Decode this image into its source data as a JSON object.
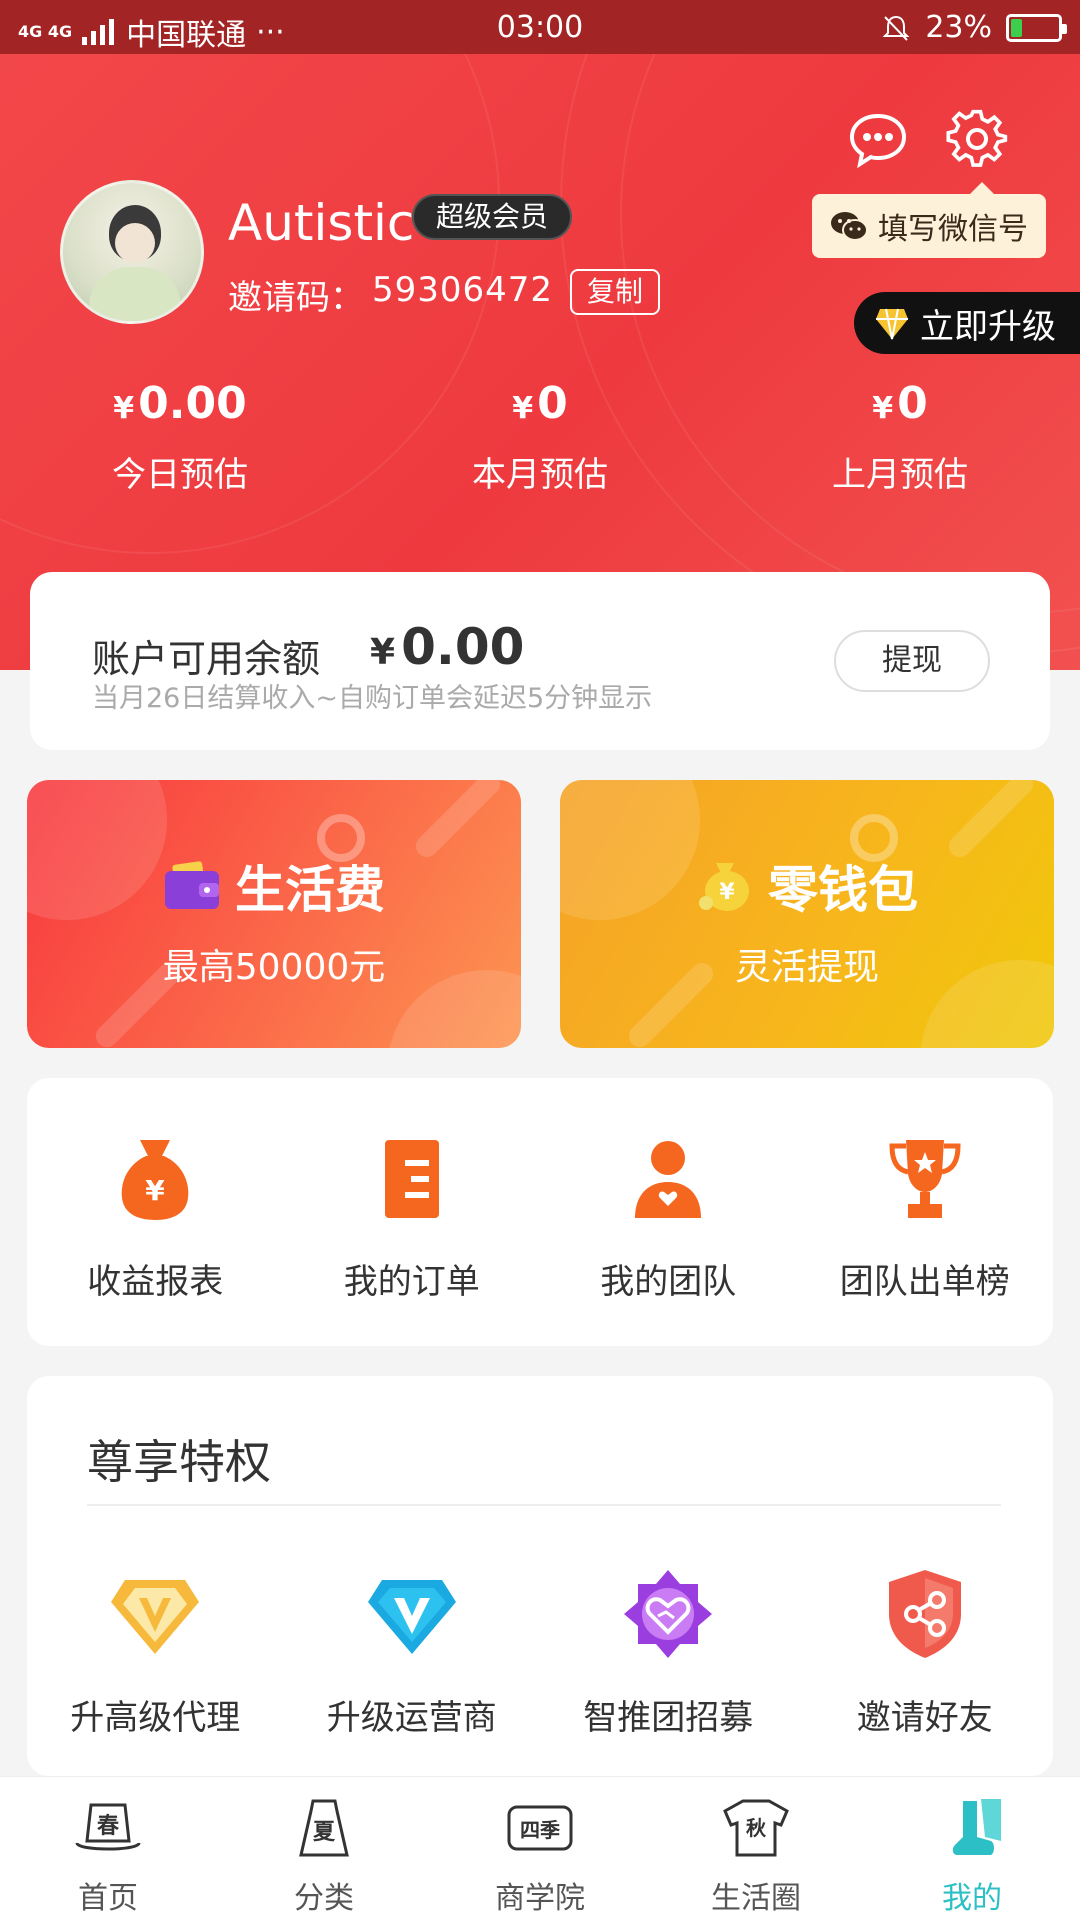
{
  "status_bar": {
    "network": "4G 4G",
    "carrier": "中国联通",
    "more": "···",
    "time": "03:00",
    "battery_text": "23%",
    "battery_level": 0.23
  },
  "profile": {
    "username": "Autistic",
    "badge": "超级会员",
    "invite_label": "邀请码：",
    "invite_code": "59306472",
    "copy_label": "复制",
    "wechat_tip": "填写微信号",
    "upgrade_label": "立即升级"
  },
  "earnings": [
    {
      "currency": "¥",
      "amount": "0.00",
      "label": "今日预估"
    },
    {
      "currency": "¥",
      "amount": "0",
      "label": "本月预估"
    },
    {
      "currency": "¥",
      "amount": "0",
      "label": "上月预估"
    }
  ],
  "balance": {
    "title": "账户可用余额",
    "currency": "¥",
    "amount": "0.00",
    "note": "当月26日结算收入~自购订单会延迟5分钟显示",
    "withdraw_label": "提现"
  },
  "promos": [
    {
      "title": "生活费",
      "subtitle": "最高50000元",
      "icon": "wallet-icon"
    },
    {
      "title": "零钱包",
      "subtitle": "灵活提现",
      "icon": "money-bag-icon"
    }
  ],
  "menu": [
    {
      "label": "收益报表",
      "icon": "money-bag-icon",
      "color": "#f5661f"
    },
    {
      "label": "我的订单",
      "icon": "order-list-icon",
      "color": "#f5661f"
    },
    {
      "label": "我的团队",
      "icon": "team-user-icon",
      "color": "#f5661f"
    },
    {
      "label": "团队出单榜",
      "icon": "trophy-icon",
      "color": "#f5661f"
    }
  ],
  "privileges": {
    "title": "尊享特权",
    "items": [
      {
        "label": "升高级代理",
        "icon": "gold-v-diamond-icon",
        "color": "#f6b93b"
      },
      {
        "label": "升级运营商",
        "icon": "blue-v-diamond-icon",
        "color": "#1aa9e0"
      },
      {
        "label": "智推团招募",
        "icon": "purple-handshake-badge-icon",
        "color": "#9b3ee0"
      },
      {
        "label": "邀请好友",
        "icon": "share-shield-icon",
        "color": "#ef5a4c"
      }
    ]
  },
  "tabs": [
    {
      "label": "首页",
      "icon": "spring-hat-icon",
      "glyph": "春",
      "active": false
    },
    {
      "label": "分类",
      "icon": "summer-bag-icon",
      "glyph": "夏",
      "active": false
    },
    {
      "label": "商学院",
      "icon": "four-seasons-icon",
      "glyph": "四季",
      "active": false
    },
    {
      "label": "生活圈",
      "icon": "autumn-shirt-icon",
      "glyph": "秋",
      "active": false
    },
    {
      "label": "我的",
      "icon": "boots-icon",
      "glyph": "",
      "active": true
    }
  ],
  "colors": {
    "header_red": "#ee3a3f",
    "accent_teal": "#2cc0c6",
    "status_bar": "#a32424"
  }
}
